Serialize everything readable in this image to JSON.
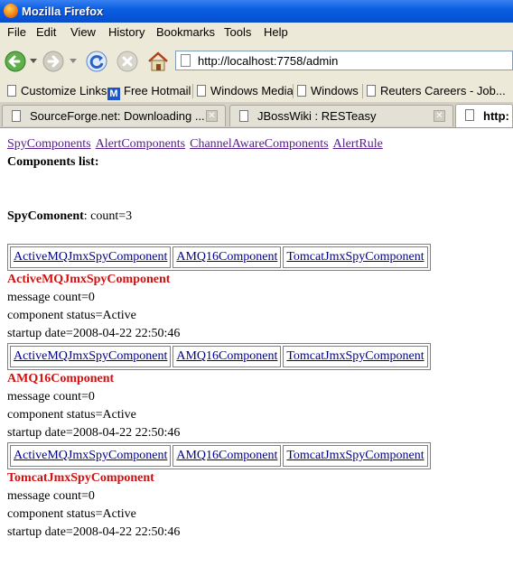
{
  "window": {
    "title": "Mozilla Firefox"
  },
  "menu": {
    "items": [
      "File",
      "Edit",
      "View",
      "History",
      "Bookmarks",
      "Tools",
      "Help"
    ]
  },
  "toolbar": {
    "url": "http://localhost:7758/admin"
  },
  "bookmarks": [
    {
      "label": "Customize Links"
    },
    {
      "label": "Free Hotmail"
    },
    {
      "label": "Windows Media"
    },
    {
      "label": "Windows"
    },
    {
      "label": "Reuters Careers - Job..."
    }
  ],
  "tabs": [
    {
      "label": "SourceForge.net: Downloading ..."
    },
    {
      "label": "JBossWiki : RESTeasy"
    },
    {
      "label": "http:"
    }
  ],
  "page": {
    "nav_links": [
      "SpyComponents",
      "AlertComponents",
      "ChannelAwareComponents",
      "AlertRule"
    ],
    "components_list_label": "Components list:",
    "spy_label": "SpyComonent",
    "spy_count": ": count=3",
    "tab_links": [
      "ActiveMQJmxSpyComponent",
      "AMQ16Component",
      "TomcatJmxSpyComponent"
    ],
    "components": [
      {
        "name": "ActiveMQJmxSpyComponent",
        "message_count": "message count=0",
        "status": "component status=Active",
        "startup": "startup date=2008-04-22 22:50:46"
      },
      {
        "name": "AMQ16Component",
        "message_count": "message count=0",
        "status": "component status=Active",
        "startup": "startup date=2008-04-22 22:50:46"
      },
      {
        "name": "TomcatJmxSpyComponent",
        "message_count": "message count=0",
        "status": "component status=Active",
        "startup": "startup date=2008-04-22 22:50:46"
      }
    ]
  }
}
